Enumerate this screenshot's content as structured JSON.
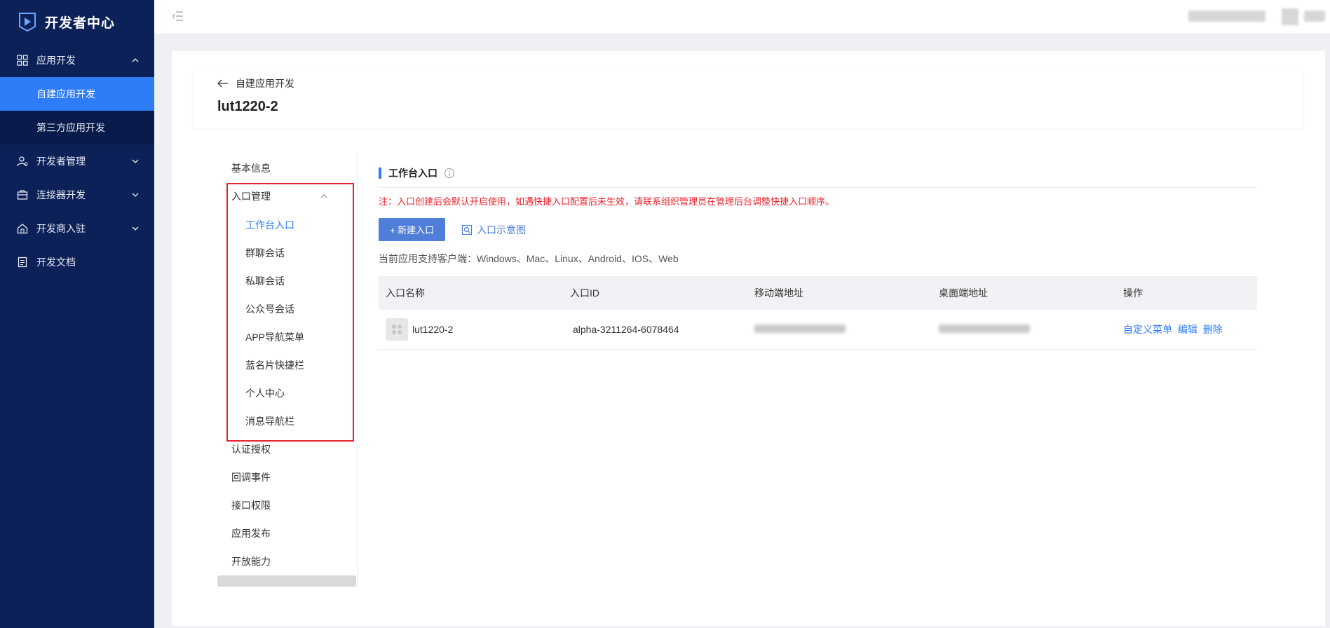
{
  "brand": {
    "title": "开发者中心"
  },
  "sidebar": {
    "groups": [
      {
        "label": "应用开发",
        "expanded": true,
        "icon": "grid-icon"
      },
      {
        "label": "开发者管理",
        "expanded": false,
        "icon": "user-gear-icon"
      },
      {
        "label": "连接器开发",
        "expanded": false,
        "icon": "briefcase-icon"
      },
      {
        "label": "开发商入驻",
        "expanded": false,
        "icon": "home-icon"
      },
      {
        "label": "开发文档",
        "icon": "document-icon"
      }
    ],
    "sub_items": [
      {
        "label": "自建应用开发",
        "active": true
      },
      {
        "label": "第三方应用开发",
        "active": false
      }
    ]
  },
  "header": {
    "back_label": "自建应用开发",
    "app_name": "lut1220-2"
  },
  "left_menu": {
    "basic_info": "基本信息",
    "entry_mgmt": "入口管理",
    "entry_sub": [
      "工作台入口",
      "群聊会话",
      "私聊会话",
      "公众号会话",
      "APP导航菜单",
      "蓝名片快捷栏",
      "个人中心",
      "消息导航栏"
    ],
    "others": [
      "认证授权",
      "回调事件",
      "接口权限",
      "应用发布",
      "开放能力"
    ]
  },
  "content": {
    "section_title": "工作台入口",
    "note": "注：入口创建后会默认开启使用，如遇快捷入口配置后未生效，请联系组织管理员在管理后台调整快捷入口顺序。",
    "new_button": "+ 新建入口",
    "diagram_link": "入口示意图",
    "platforms": "当前应用支持客户端：Windows、Mac、Linux、Android、IOS、Web",
    "table": {
      "headers": [
        "入口名称",
        "入口ID",
        "移动端地址",
        "桌面端地址",
        "操作"
      ],
      "rows": [
        {
          "name": "lut1220-2",
          "id": "alpha-3211264-6078464",
          "actions": [
            "自定义菜单",
            "编辑",
            "删除"
          ]
        }
      ]
    }
  },
  "colors": {
    "sidebar_bg": "#0c2157",
    "accent": "#2e7cf6",
    "button": "#4f7fd8",
    "warning": "#e8232e"
  }
}
